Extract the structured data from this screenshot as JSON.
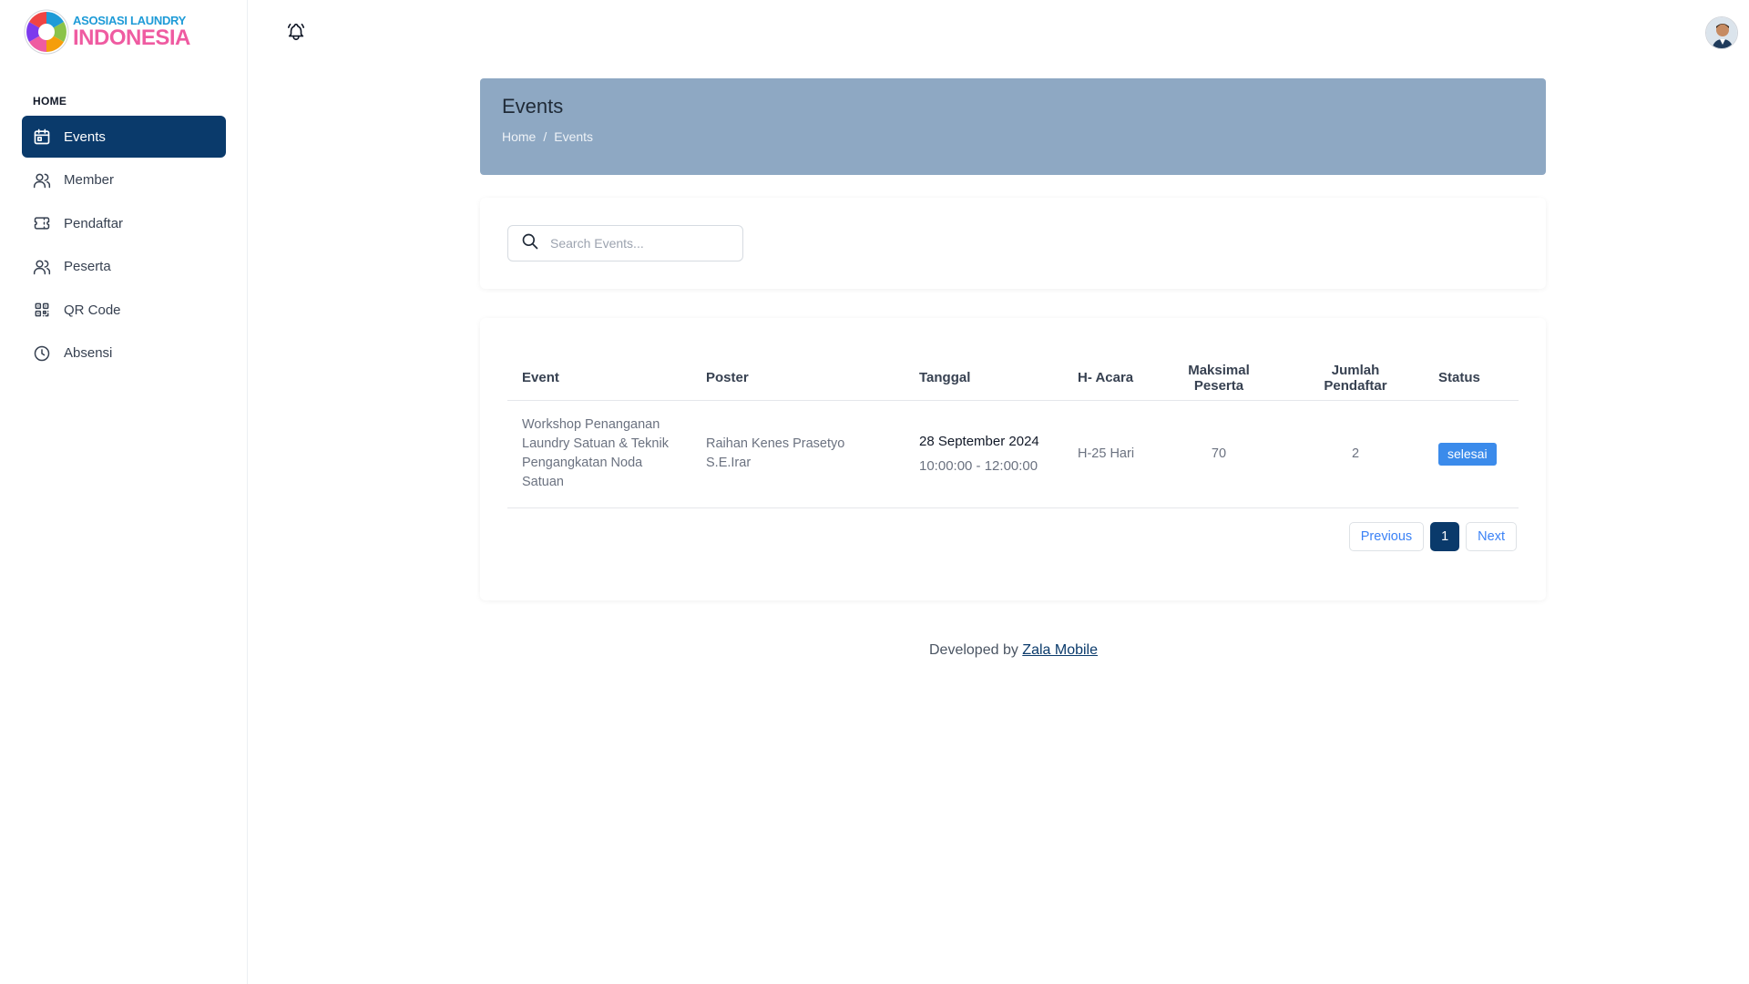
{
  "brand": {
    "line1": "ASOSIASI LAUNDRY",
    "line2": "INDONESIA"
  },
  "sidebar": {
    "section_label": "HOME",
    "items": [
      {
        "label": "Events",
        "icon": "calendar-icon",
        "active": true
      },
      {
        "label": "Member",
        "icon": "users-icon",
        "active": false
      },
      {
        "label": "Pendaftar",
        "icon": "ticket-icon",
        "active": false
      },
      {
        "label": "Peserta",
        "icon": "users-icon",
        "active": false
      },
      {
        "label": "QR Code",
        "icon": "qr-code-icon",
        "active": false
      },
      {
        "label": "Absensi",
        "icon": "clock-icon",
        "active": false
      }
    ]
  },
  "topbar": {
    "bell_icon": "bell-icon",
    "avatar": "user-avatar"
  },
  "header": {
    "title": "Events",
    "breadcrumb": [
      "Home",
      "/",
      "Events"
    ]
  },
  "search": {
    "placeholder": "Search Events..."
  },
  "table": {
    "columns": [
      "Event",
      "Poster",
      "Tanggal",
      "H- Acara",
      "Maksimal Peserta",
      "Jumlah Pendaftar",
      "Status"
    ],
    "rows": [
      {
        "event": "Workshop Penanganan Laundry Satuan & Teknik Pengangkatan Noda Satuan",
        "poster": "Raihan Kenes Prasetyo S.E.Irar",
        "date": "28 September 2024",
        "time": "10:00:00 - 12:00:00",
        "h_acara": "H-25 Hari",
        "max_peserta": "70",
        "jumlah_pendaftar": "2",
        "status": "selesai"
      }
    ]
  },
  "pagination": {
    "previous": "Previous",
    "current": "1",
    "next": "Next"
  },
  "footer": {
    "text": "Developed by",
    "link": "Zala Mobile"
  },
  "colors": {
    "primary": "#0a3a6b",
    "banner": "#8ea8c3",
    "badge": "#3b8beb",
    "link": "#3b82f6"
  }
}
